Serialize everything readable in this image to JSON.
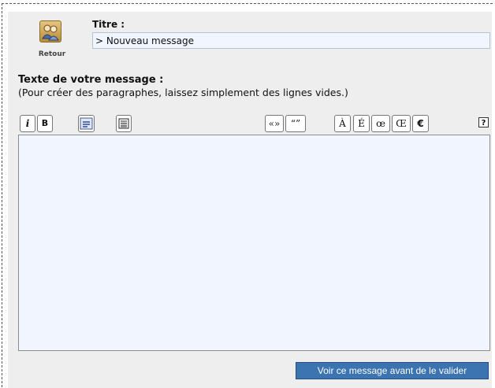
{
  "header": {
    "retour_label": "Retour",
    "titre_label": "Titre :",
    "titre_value": "> Nouveau message"
  },
  "message": {
    "title": "Texte de votre message :",
    "hint": "(Pour créer des paragraphes, laissez simplement des lignes vides.)",
    "value": ""
  },
  "toolbar": {
    "italic": "i",
    "bold": "B",
    "spip_icon": "spip-link-icon",
    "paragraph_icon": "paragraph-icon",
    "quote_french": "«»",
    "quote_english": "“”",
    "chars": [
      "À",
      "É",
      "œ",
      "Œ",
      "€"
    ],
    "help": "?"
  },
  "actions": {
    "preview": "Voir ce message avant de le valider"
  },
  "colors": {
    "panel_bg": "#eeeeee",
    "field_bg": "#f1f5ff",
    "button_blue": "#3b74b0"
  }
}
